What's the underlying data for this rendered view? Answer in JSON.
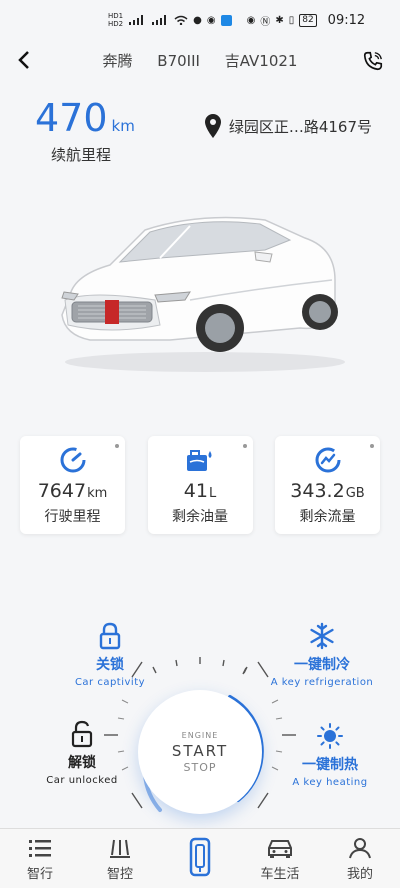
{
  "status_bar": {
    "signal_1": "HD1",
    "signal_2": "HD2",
    "battery": "82",
    "time": "09:12"
  },
  "header": {
    "brand": "奔腾",
    "model": "B70III",
    "plate": "吉AV1021"
  },
  "range": {
    "value": "470",
    "unit": "km",
    "label": "续航里程"
  },
  "location": {
    "text": "绿园区正…路4167号"
  },
  "cards": [
    {
      "icon": "speedometer-icon",
      "value": "7647",
      "unit": "km",
      "label": "行驶里程"
    },
    {
      "icon": "fuel-icon",
      "value": "41",
      "unit": "L",
      "label": "剩余油量"
    },
    {
      "icon": "data-usage-icon",
      "value": "343.2",
      "unit": "GB",
      "label": "剩余流量"
    }
  ],
  "controls": {
    "lock": {
      "title": "关锁",
      "sub": "Car captivity"
    },
    "unlock": {
      "title": "解锁",
      "sub": "Car  unlocked"
    },
    "cool": {
      "title": "一键制冷",
      "sub": "A key refrigeration"
    },
    "heat": {
      "title": "一键制热",
      "sub": "A key heating"
    },
    "engine": {
      "top": "ENGINE",
      "main": "START",
      "bottom": "STOP"
    }
  },
  "nav": [
    {
      "label": "智行",
      "icon": "list-icon"
    },
    {
      "label": "智控",
      "icon": "control-icon"
    },
    {
      "label": "",
      "icon": "car-key-icon"
    },
    {
      "label": "车生活",
      "icon": "car-icon"
    },
    {
      "label": "我的",
      "icon": "user-icon"
    }
  ],
  "colors": {
    "accent": "#2b72d8",
    "background": "#f5f6f8"
  }
}
